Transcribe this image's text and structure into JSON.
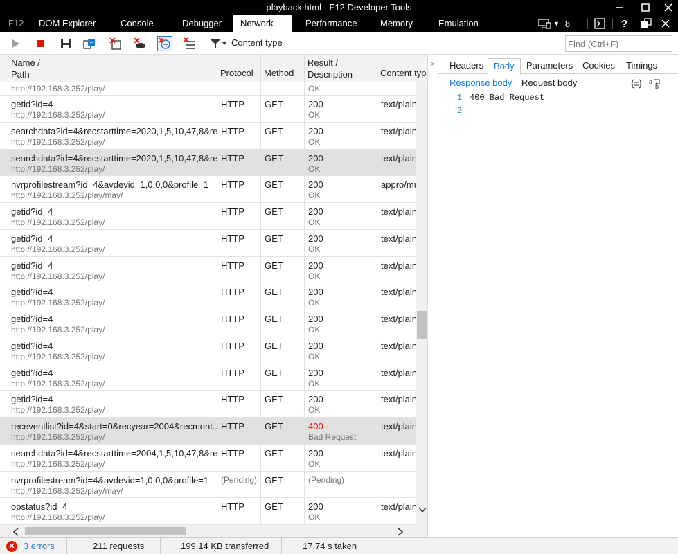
{
  "window": {
    "title": "playback.html - F12 Developer Tools"
  },
  "main_tabs": [
    {
      "label": "F12"
    },
    {
      "label": "DOM Explorer"
    },
    {
      "label": "Console"
    },
    {
      "label": "Debugger"
    },
    {
      "label": "Network"
    },
    {
      "label": "Performance"
    },
    {
      "label": "Memory"
    },
    {
      "label": "Emulation"
    }
  ],
  "active_tab": "Network",
  "target_count": "8",
  "toolbar": {
    "filter_label": "Content type",
    "find_placeholder": "Find (Ctrl+F)"
  },
  "grid_headers": {
    "name": "Name /",
    "path": "Path",
    "protocol": "Protocol",
    "method": "Method",
    "result": "Result /",
    "description": "Description",
    "content_type": "Content type"
  },
  "requests": [
    {
      "name": "",
      "path": "http://192.168.3.252/play/",
      "protocol": "",
      "method": "",
      "result": "",
      "description": "OK",
      "content_type": ""
    },
    {
      "name": "getid?id=4",
      "path": "http://192.168.3.252/play/",
      "protocol": "HTTP",
      "method": "GET",
      "result": "200",
      "description": "OK",
      "content_type": "text/plain"
    },
    {
      "name": "searchdata?id=4&recstarttime=2020,1,5,10,47,8&re...",
      "path": "http://192.168.3.252/play/",
      "protocol": "HTTP",
      "method": "GET",
      "result": "200",
      "description": "OK",
      "content_type": "text/plain"
    },
    {
      "name": "searchdata?id=4&recstarttime=2020,1,5,10,47,8&re...",
      "path": "http://192.168.3.252/play/",
      "protocol": "HTTP",
      "method": "GET",
      "result": "200",
      "description": "OK",
      "content_type": "text/plain",
      "selected": true
    },
    {
      "name": "nvrprofilestream?id=4&avdevid=1,0,0,0&profile=1",
      "path": "http://192.168.3.252/play/mav/",
      "protocol": "HTTP",
      "method": "GET",
      "result": "200",
      "description": "OK",
      "content_type": "appro/mu"
    },
    {
      "name": "getid?id=4",
      "path": "http://192.168.3.252/play/",
      "protocol": "HTTP",
      "method": "GET",
      "result": "200",
      "description": "OK",
      "content_type": "text/plain"
    },
    {
      "name": "getid?id=4",
      "path": "http://192.168.3.252/play/",
      "protocol": "HTTP",
      "method": "GET",
      "result": "200",
      "description": "OK",
      "content_type": "text/plain"
    },
    {
      "name": "getid?id=4",
      "path": "http://192.168.3.252/play/",
      "protocol": "HTTP",
      "method": "GET",
      "result": "200",
      "description": "OK",
      "content_type": "text/plain"
    },
    {
      "name": "getid?id=4",
      "path": "http://192.168.3.252/play/",
      "protocol": "HTTP",
      "method": "GET",
      "result": "200",
      "description": "OK",
      "content_type": "text/plain"
    },
    {
      "name": "getid?id=4",
      "path": "http://192.168.3.252/play/",
      "protocol": "HTTP",
      "method": "GET",
      "result": "200",
      "description": "OK",
      "content_type": "text/plain"
    },
    {
      "name": "getid?id=4",
      "path": "http://192.168.3.252/play/",
      "protocol": "HTTP",
      "method": "GET",
      "result": "200",
      "description": "OK",
      "content_type": "text/plain"
    },
    {
      "name": "getid?id=4",
      "path": "http://192.168.3.252/play/",
      "protocol": "HTTP",
      "method": "GET",
      "result": "200",
      "description": "OK",
      "content_type": "text/plain"
    },
    {
      "name": "getid?id=4",
      "path": "http://192.168.3.252/play/",
      "protocol": "HTTP",
      "method": "GET",
      "result": "200",
      "description": "OK",
      "content_type": "text/plain"
    },
    {
      "name": "receventlist?id=4&start=0&recyear=2004&recmont...",
      "path": "http://192.168.3.252/play/",
      "protocol": "HTTP",
      "method": "GET",
      "result": "400",
      "description": "Bad Request",
      "content_type": "text/plain",
      "selected": true,
      "error": true
    },
    {
      "name": "searchdata?id=4&recstarttime=2004,1,5,10,47,8&re...",
      "path": "http://192.168.3.252/play/",
      "protocol": "HTTP",
      "method": "GET",
      "result": "200",
      "description": "OK",
      "content_type": "text/plain"
    },
    {
      "name": "nvrprofilestream?id=4&avdevid=1,0,0,0&profile=1",
      "path": "http://192.168.3.252/play/mav/",
      "protocol": "(Pending)",
      "method": "GET",
      "result": "(Pending)",
      "description": "",
      "content_type": "",
      "pending": true
    },
    {
      "name": "opstatus?id=4",
      "path": "http://192.168.3.252/play/",
      "protocol": "HTTP",
      "method": "GET",
      "result": "200",
      "description": "OK",
      "content_type": "text/plain"
    }
  ],
  "detail": {
    "tabs": [
      {
        "label": "Headers"
      },
      {
        "label": "Body"
      },
      {
        "label": "Parameters"
      },
      {
        "label": "Cookies"
      },
      {
        "label": "Timings"
      }
    ],
    "active_tab": "Body",
    "subtabs": [
      {
        "label": "Response body"
      },
      {
        "label": "Request body"
      }
    ],
    "active_subtab": "Response body",
    "body_lines": [
      {
        "num": "1",
        "text": "400 Bad Request"
      },
      {
        "num": "2",
        "text": ""
      }
    ]
  },
  "status": {
    "errors": "3 errors",
    "requests": "211 requests",
    "transferred": "199.14 KB transferred",
    "time": "17.74 s taken"
  },
  "colors": {
    "accent": "#1c7ad5",
    "error": "#e51400",
    "titlebar": "#000000",
    "selected_row": "#e0e0e0"
  },
  "icons": [
    "play-icon",
    "stop-icon",
    "save-icon",
    "export-har-icon",
    "clear-entries-icon",
    "clear-cache-icon",
    "always-refresh-icon",
    "clear-cookies-icon",
    "filter-icon",
    "target-device-icon",
    "console-icon",
    "help-icon",
    "undock-icon",
    "minimize-icon",
    "maximize-icon",
    "close-icon",
    "pretty-print-icon",
    "word-wrap-icon",
    "error-icon"
  ]
}
